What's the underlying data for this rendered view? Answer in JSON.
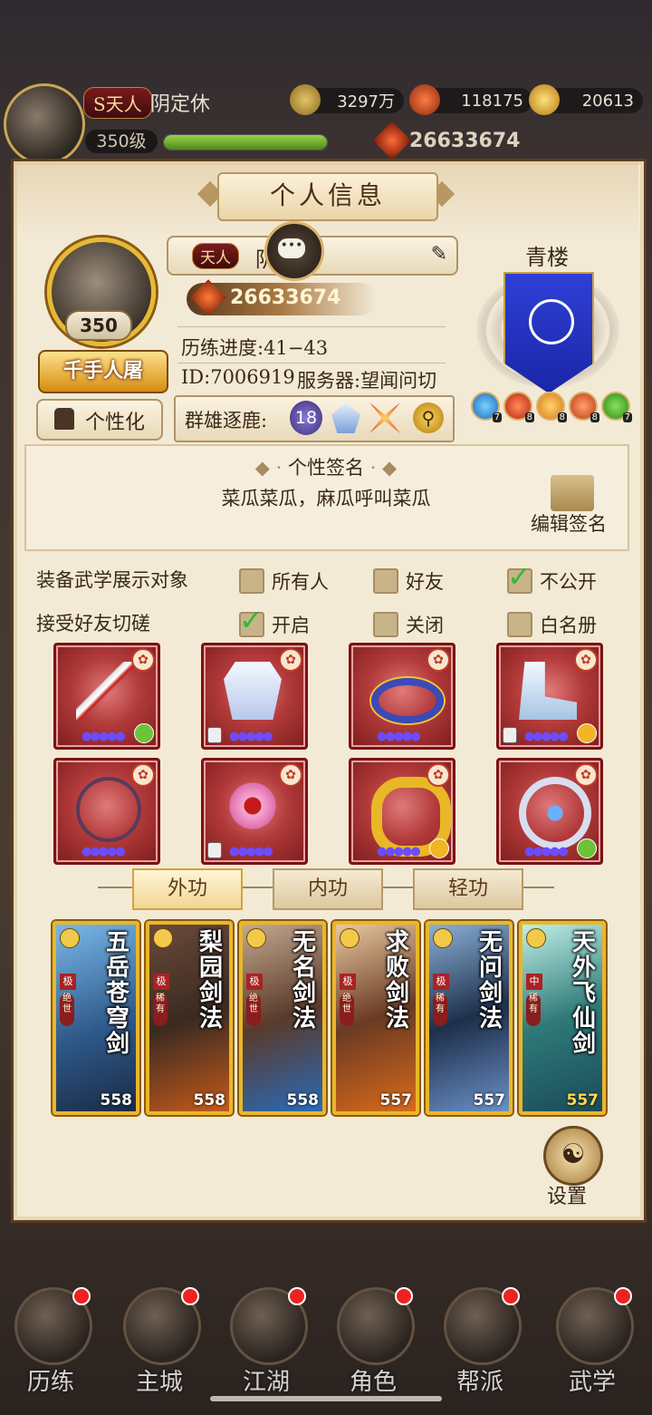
{
  "player": {
    "tier_tag": "天人",
    "tier_prefix": "S",
    "name": "阴定休",
    "level": "350级",
    "power": "26633674"
  },
  "resources": {
    "coins": "3297万",
    "gems": "118175",
    "gold": "20613"
  },
  "panel": {
    "title": "个人信息",
    "avatar_level": "350",
    "title_badge": "千手人屠",
    "customize_label": "个性化",
    "name_tag": "天人",
    "name_visible": "阴",
    "name_hidden_tail": "休",
    "power": "26633674",
    "progress": "历练进度:41−43",
    "id": "ID:7006919",
    "server": "服务器:望闻问切",
    "arena_label": "群雄逐鹿:",
    "arena_rank": "18",
    "guild_name": "青楼",
    "gem_levels": [
      "7",
      "8",
      "8",
      "8",
      "7"
    ]
  },
  "signature": {
    "heading": "个性签名",
    "text": "菜瓜菜瓜，麻瓜呼叫菜瓜",
    "edit_label": "编辑签名"
  },
  "settings": {
    "equip_display_label": "装备武学展示对象",
    "equip_options": [
      {
        "label": "所有人",
        "checked": false
      },
      {
        "label": "好友",
        "checked": false
      },
      {
        "label": "不公开",
        "checked": true
      }
    ],
    "spar_label": "接受好友切磋",
    "spar_options": [
      {
        "label": "开启",
        "checked": true
      },
      {
        "label": "关闭",
        "checked": false
      },
      {
        "label": "白名册",
        "checked": false
      }
    ]
  },
  "equipment": [
    {
      "name": "sword-icon",
      "stars": "●●●●●",
      "link": "green",
      "lock": false
    },
    {
      "name": "robe-icon",
      "stars": "●●●●●",
      "link": "none",
      "lock": true
    },
    {
      "name": "belt-icon",
      "stars": "●●●●●",
      "link": "none",
      "lock": false
    },
    {
      "name": "boots-icon",
      "stars": "●●●●●",
      "link": "gold",
      "lock": true
    },
    {
      "name": "necklace-icon",
      "stars": "●●●●●",
      "link": "none",
      "lock": false
    },
    {
      "name": "hairpin-icon",
      "stars": "●●●●●",
      "link": "none",
      "lock": true
    },
    {
      "name": "bracelet-icon",
      "stars": "●●●●●",
      "link": "gold",
      "lock": false
    },
    {
      "name": "ring-icon",
      "stars": "●●●●●",
      "link": "green",
      "lock": false
    }
  ],
  "tabs": [
    {
      "label": "外功",
      "active": true
    },
    {
      "label": "内功",
      "active": false
    },
    {
      "label": "轻功",
      "active": false
    }
  ],
  "skills": [
    {
      "name": "五岳苍穹剑",
      "level": "558",
      "tier": "极",
      "rank": "绝世",
      "bg": "#2f5a8c"
    },
    {
      "name": "梨园剑法",
      "level": "558",
      "tier": "极",
      "rank": "稀有",
      "bg": "#3a2a20"
    },
    {
      "name": "无名剑法",
      "level": "558",
      "tier": "极",
      "rank": "绝世",
      "bg": "#5a3a2a"
    },
    {
      "name": "求败剑法",
      "level": "557",
      "tier": "极",
      "rank": "绝世",
      "bg": "#6a3a22"
    },
    {
      "name": "无问剑法",
      "level": "557",
      "tier": "极",
      "rank": "稀有",
      "bg": "#1e2f4a"
    },
    {
      "name": "天外飞仙剑",
      "level": "557",
      "tier": "中",
      "rank": "稀有",
      "bg": "#2f7a78"
    }
  ],
  "settings_button": "设置",
  "nav": [
    {
      "label": "历练"
    },
    {
      "label": "主城"
    },
    {
      "label": "江湖"
    },
    {
      "label": "角色"
    },
    {
      "label": "帮派"
    },
    {
      "label": "武学"
    }
  ],
  "colors": {
    "panel_bg": "#f3ead6",
    "accent_gold": "#e9b62a",
    "equip_red": "#b23a3a",
    "check_green": "#2dbb33"
  }
}
